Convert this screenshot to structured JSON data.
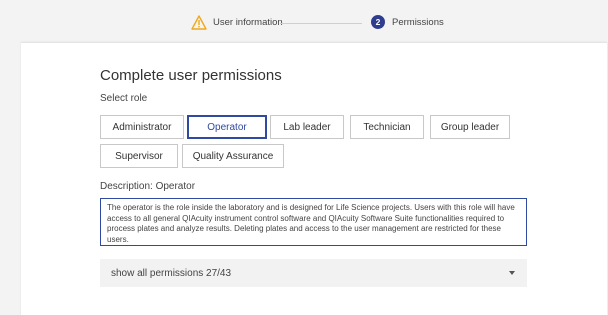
{
  "stepper": {
    "step1_label": "User information",
    "step2_number": "2",
    "step2_label": "Permissions"
  },
  "page": {
    "title": "Complete user permissions",
    "select_role_label": "Select role"
  },
  "roles": [
    {
      "label": "Administrator",
      "selected": false
    },
    {
      "label": "Operator",
      "selected": true
    },
    {
      "label": "Lab leader",
      "selected": false
    },
    {
      "label": "Technician",
      "selected": false
    },
    {
      "label": "Group leader",
      "selected": false
    },
    {
      "label": "Supervisor",
      "selected": false
    },
    {
      "label": "Quality Assurance",
      "selected": false
    }
  ],
  "description": {
    "label": "Description: Operator",
    "text": "The operator is the role inside the laboratory and is designed for Life Science projects. Users with this role will have access to all general QIAcuity instrument control software and QIAcuity Software Suite functionalities required to process plates and analyze results. Deleting plates and access to the user management are restricted for these users."
  },
  "permissions": {
    "toggle_label": "show all permissions 27/43"
  },
  "colors": {
    "accent": "#2f4aa0",
    "step_active": "#2f3d8f",
    "warning": "#f0a81c"
  },
  "icons": {
    "step1": "warning-icon",
    "toggle": "caret-down-icon"
  }
}
